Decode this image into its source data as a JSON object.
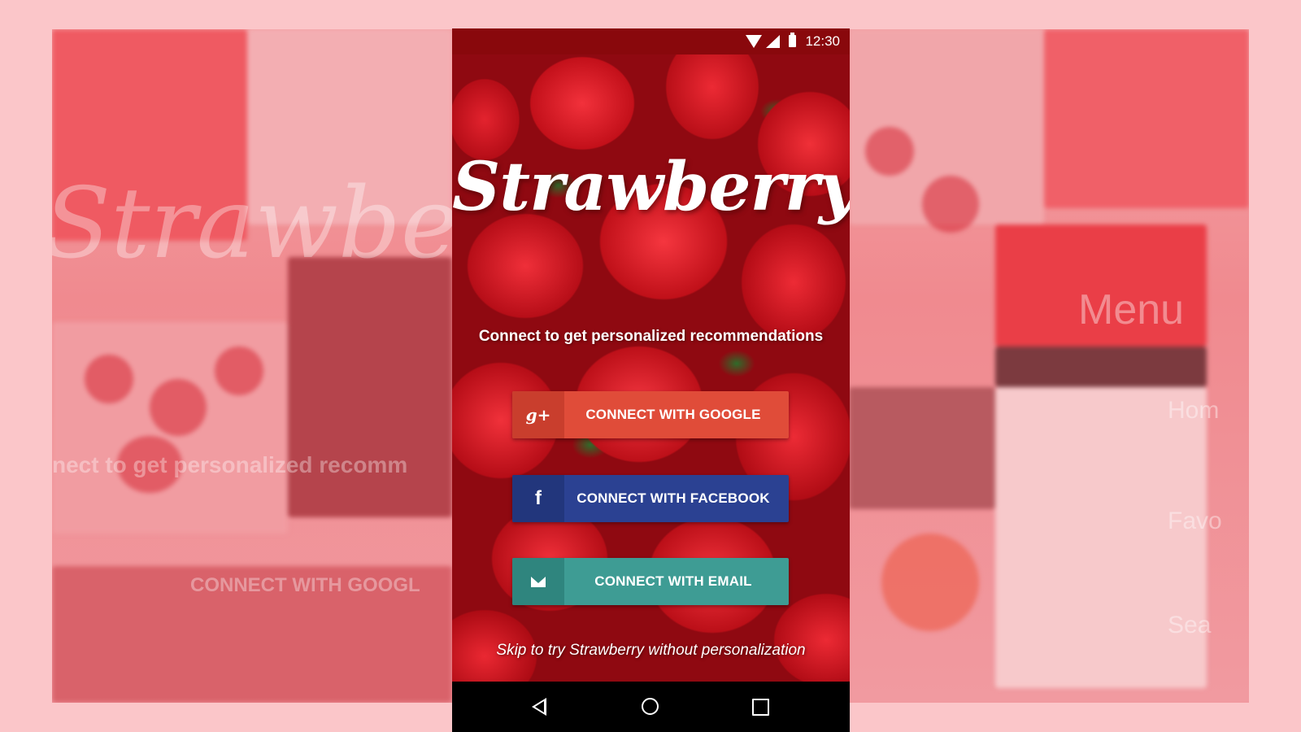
{
  "status_bar": {
    "time": "12:30"
  },
  "app": {
    "logo_text": "Strawberry",
    "tagline": "Connect to get personalized recommendations",
    "skip_text": "Skip to try Strawberry without personalization"
  },
  "buttons": {
    "google": {
      "icon_text": "g+",
      "label": "CONNECT WITH GOOGLE",
      "color": "#e04c39"
    },
    "facebook": {
      "icon_text": "f",
      "label": "CONNECT WITH FACEBOOK",
      "color": "#2b4192"
    },
    "email": {
      "label": "CONNECT WITH EMAIL",
      "color": "#3e9c94"
    }
  },
  "background": {
    "left": {
      "logo_text": "Strawberry",
      "tagline_fragment": "nect to get personalized recomm",
      "button_fragment": "CONNECT WITH GOOGL"
    },
    "right": {
      "menu_title": "Menu",
      "items": [
        "Hom",
        "Favo",
        "Sea"
      ]
    }
  },
  "colors": {
    "accent": "#fbc6c9",
    "nav_bar": "#000000"
  }
}
